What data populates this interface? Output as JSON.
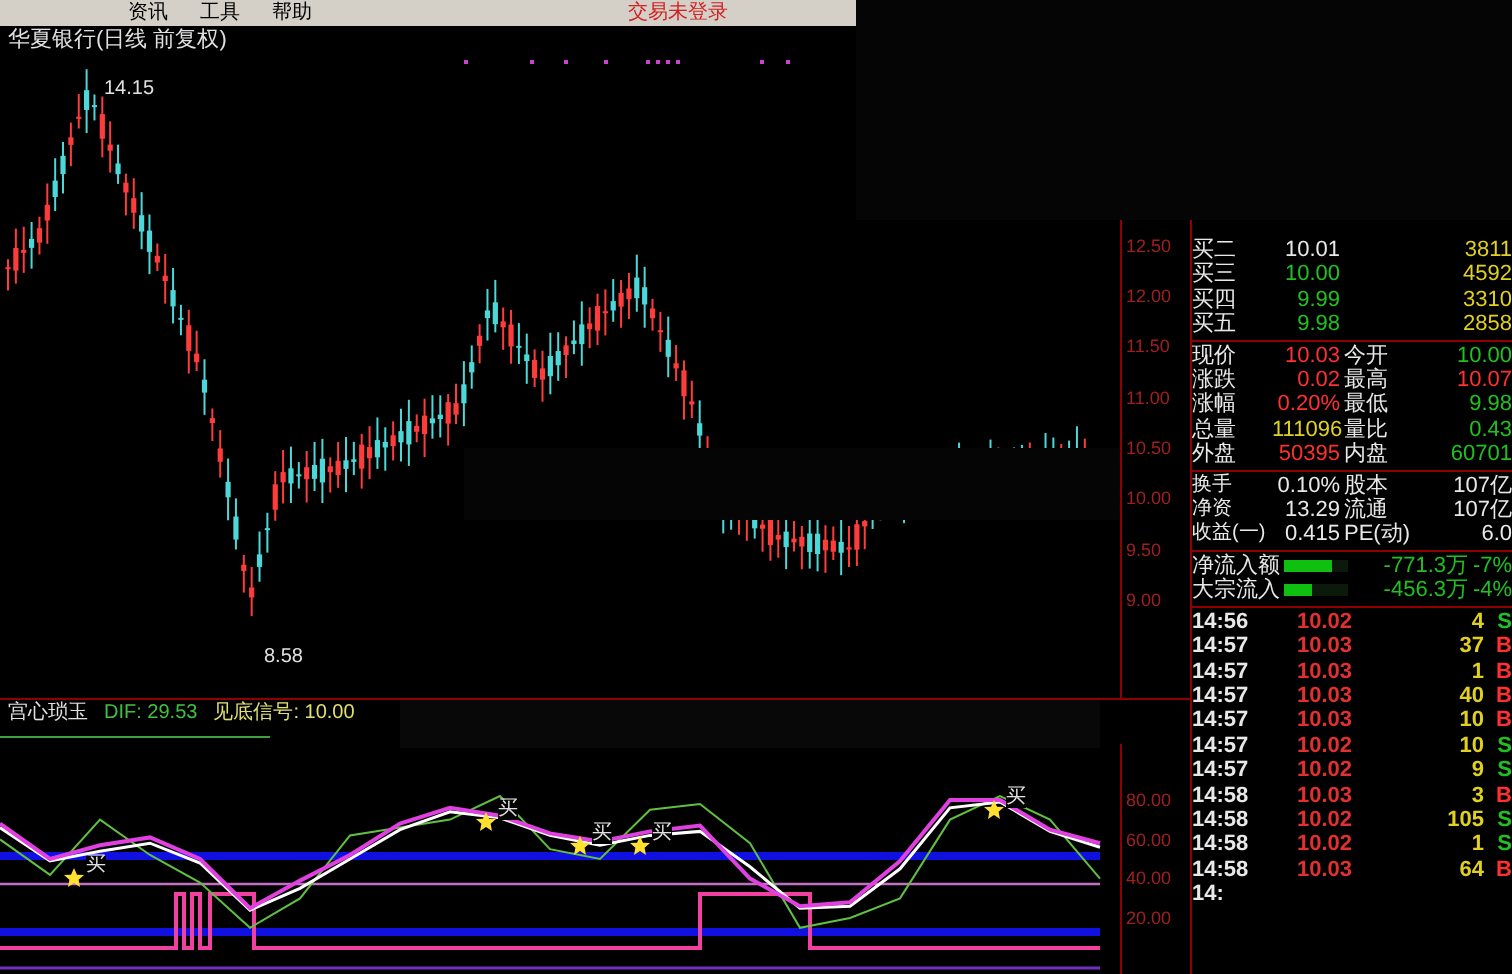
{
  "menu_bar": {
    "items": [
      "资讯",
      "工具",
      "帮助"
    ],
    "status": "交易未登录"
  },
  "chart": {
    "title": "华夏银行(日线 前复权)",
    "high_label": "14.15",
    "low_label": "8.58",
    "price_axis": [
      "12.50",
      "12.00",
      "11.50",
      "11.00",
      "10.50",
      "10.00",
      "9.50",
      "9.00"
    ]
  },
  "indicator": {
    "name": "宫心琐玉",
    "dif": "DIF: 29.53",
    "signal": "见底信号: 10.00",
    "chart_data": {
      "type": "line",
      "ylim": [
        -8.5,
        108.5
      ],
      "yticks": [
        {
          "value": 80,
          "label": "80.00"
        },
        {
          "value": 60,
          "label": "60.00"
        },
        {
          "value": 40,
          "label": "40.00"
        },
        {
          "value": 20,
          "label": "20.00"
        }
      ],
      "series": [
        {
          "color": "#60c040",
          "values": [
            60,
            42,
            70,
            52,
            38,
            15,
            30,
            62,
            66,
            70,
            82,
            55,
            50,
            75,
            78,
            58,
            15,
            20,
            30,
            70,
            82,
            70,
            40
          ]
        },
        {
          "color": "#ffffff",
          "values": [
            66,
            49,
            54,
            58,
            48,
            24,
            35,
            50,
            65,
            74,
            71,
            62,
            57,
            62,
            64,
            46,
            25,
            26,
            45,
            76,
            79,
            64,
            56
          ]
        },
        {
          "color": "#e040e0",
          "values": [
            68,
            50,
            57,
            61,
            50,
            25,
            39,
            52,
            68,
            76,
            72,
            63,
            59,
            64,
            67,
            40,
            26,
            28,
            49,
            80,
            80,
            65,
            58
          ]
        }
      ]
    },
    "markers": [
      {
        "label": "买"
      },
      {
        "label": "买"
      },
      {
        "label": "买"
      },
      {
        "label": "买"
      },
      {
        "label": "买"
      }
    ]
  },
  "quote": {
    "rows": [
      {
        "label": "买二",
        "value": "10.01",
        "color": "#e8e8e8",
        "volume": "3811"
      },
      {
        "label": "买三",
        "value": "10.00",
        "color": "#20c020",
        "volume": "4592"
      },
      {
        "label": "买四",
        "value": "9.99",
        "color": "#20c020",
        "volume": "3310"
      },
      {
        "label": "买五",
        "value": "9.98",
        "color": "#20c020",
        "volume": "2858"
      }
    ],
    "stats": [
      {
        "cells": [
          {
            "label": "现价",
            "value": "10.03",
            "color": "#ff3030"
          },
          {
            "label": "今开",
            "value": "10.00",
            "color": "#20c020"
          }
        ]
      },
      {
        "cells": [
          {
            "label": "涨跌",
            "value": "0.02",
            "color": "#ff3030"
          },
          {
            "label": "最高",
            "value": "10.07",
            "color": "#ff3030"
          }
        ]
      },
      {
        "cells": [
          {
            "label": "涨幅",
            "value": "0.20%",
            "color": "#ff3030"
          },
          {
            "label": "最低",
            "value": "9.98",
            "color": "#20c020"
          }
        ]
      },
      {
        "cells": [
          {
            "label": "总量",
            "value": "111096",
            "color": "#e0d020"
          },
          {
            "label": "量比",
            "value": "0.43",
            "color": "#20c020"
          }
        ]
      },
      {
        "cells": [
          {
            "label": "外盘",
            "value": "50395",
            "color": "#ff3030"
          },
          {
            "label": "内盘",
            "value": "60701",
            "color": "#20c020"
          }
        ]
      }
    ],
    "fundamentals": [
      {
        "label": "换手",
        "value": "0.10%",
        "label2": "股本",
        "value2": "107亿"
      },
      {
        "label": "净资",
        "value": "13.29",
        "label2": "流通",
        "value2": "107亿"
      },
      {
        "label": "收益(一)",
        "value": "0.415",
        "label2": "PE(动)",
        "value2": "6.0"
      }
    ],
    "flows": [
      {
        "label": "净流入额",
        "level": 0.75,
        "value": "-771.3万",
        "percent": "-7%"
      },
      {
        "label": "大宗流入",
        "level": 0.45,
        "value": "-456.3万",
        "percent": "-4%"
      }
    ],
    "trades": [
      {
        "time": "14:56",
        "price": "10.02",
        "volume": "4",
        "side": "S",
        "kind": "sell"
      },
      {
        "time": "14:57",
        "price": "10.03",
        "volume": "37",
        "side": "B",
        "kind": "buy"
      },
      {
        "time": "14:57",
        "price": "10.03",
        "volume": "1",
        "side": "B",
        "kind": "buy"
      },
      {
        "time": "14:57",
        "price": "10.03",
        "volume": "40",
        "side": "B",
        "kind": "buy"
      },
      {
        "time": "14:57",
        "price": "10.03",
        "volume": "10",
        "side": "B",
        "kind": "buy"
      },
      {
        "time": "14:57",
        "price": "10.02",
        "volume": "10",
        "side": "S",
        "kind": "sell"
      },
      {
        "time": "14:57",
        "price": "10.02",
        "volume": "9",
        "side": "S",
        "kind": "sell"
      },
      {
        "time": "14:58",
        "price": "10.03",
        "volume": "3",
        "side": "B",
        "kind": "buy"
      },
      {
        "time": "14:58",
        "price": "10.02",
        "volume": "105",
        "side": "S",
        "kind": "sell"
      },
      {
        "time": "14:58",
        "price": "10.02",
        "volume": "1",
        "side": "S",
        "kind": "sell"
      },
      {
        "time": "14:58",
        "price": "10.03",
        "volume": "64",
        "side": "B",
        "kind": "buy"
      }
    ],
    "partial_time": "14:"
  }
}
